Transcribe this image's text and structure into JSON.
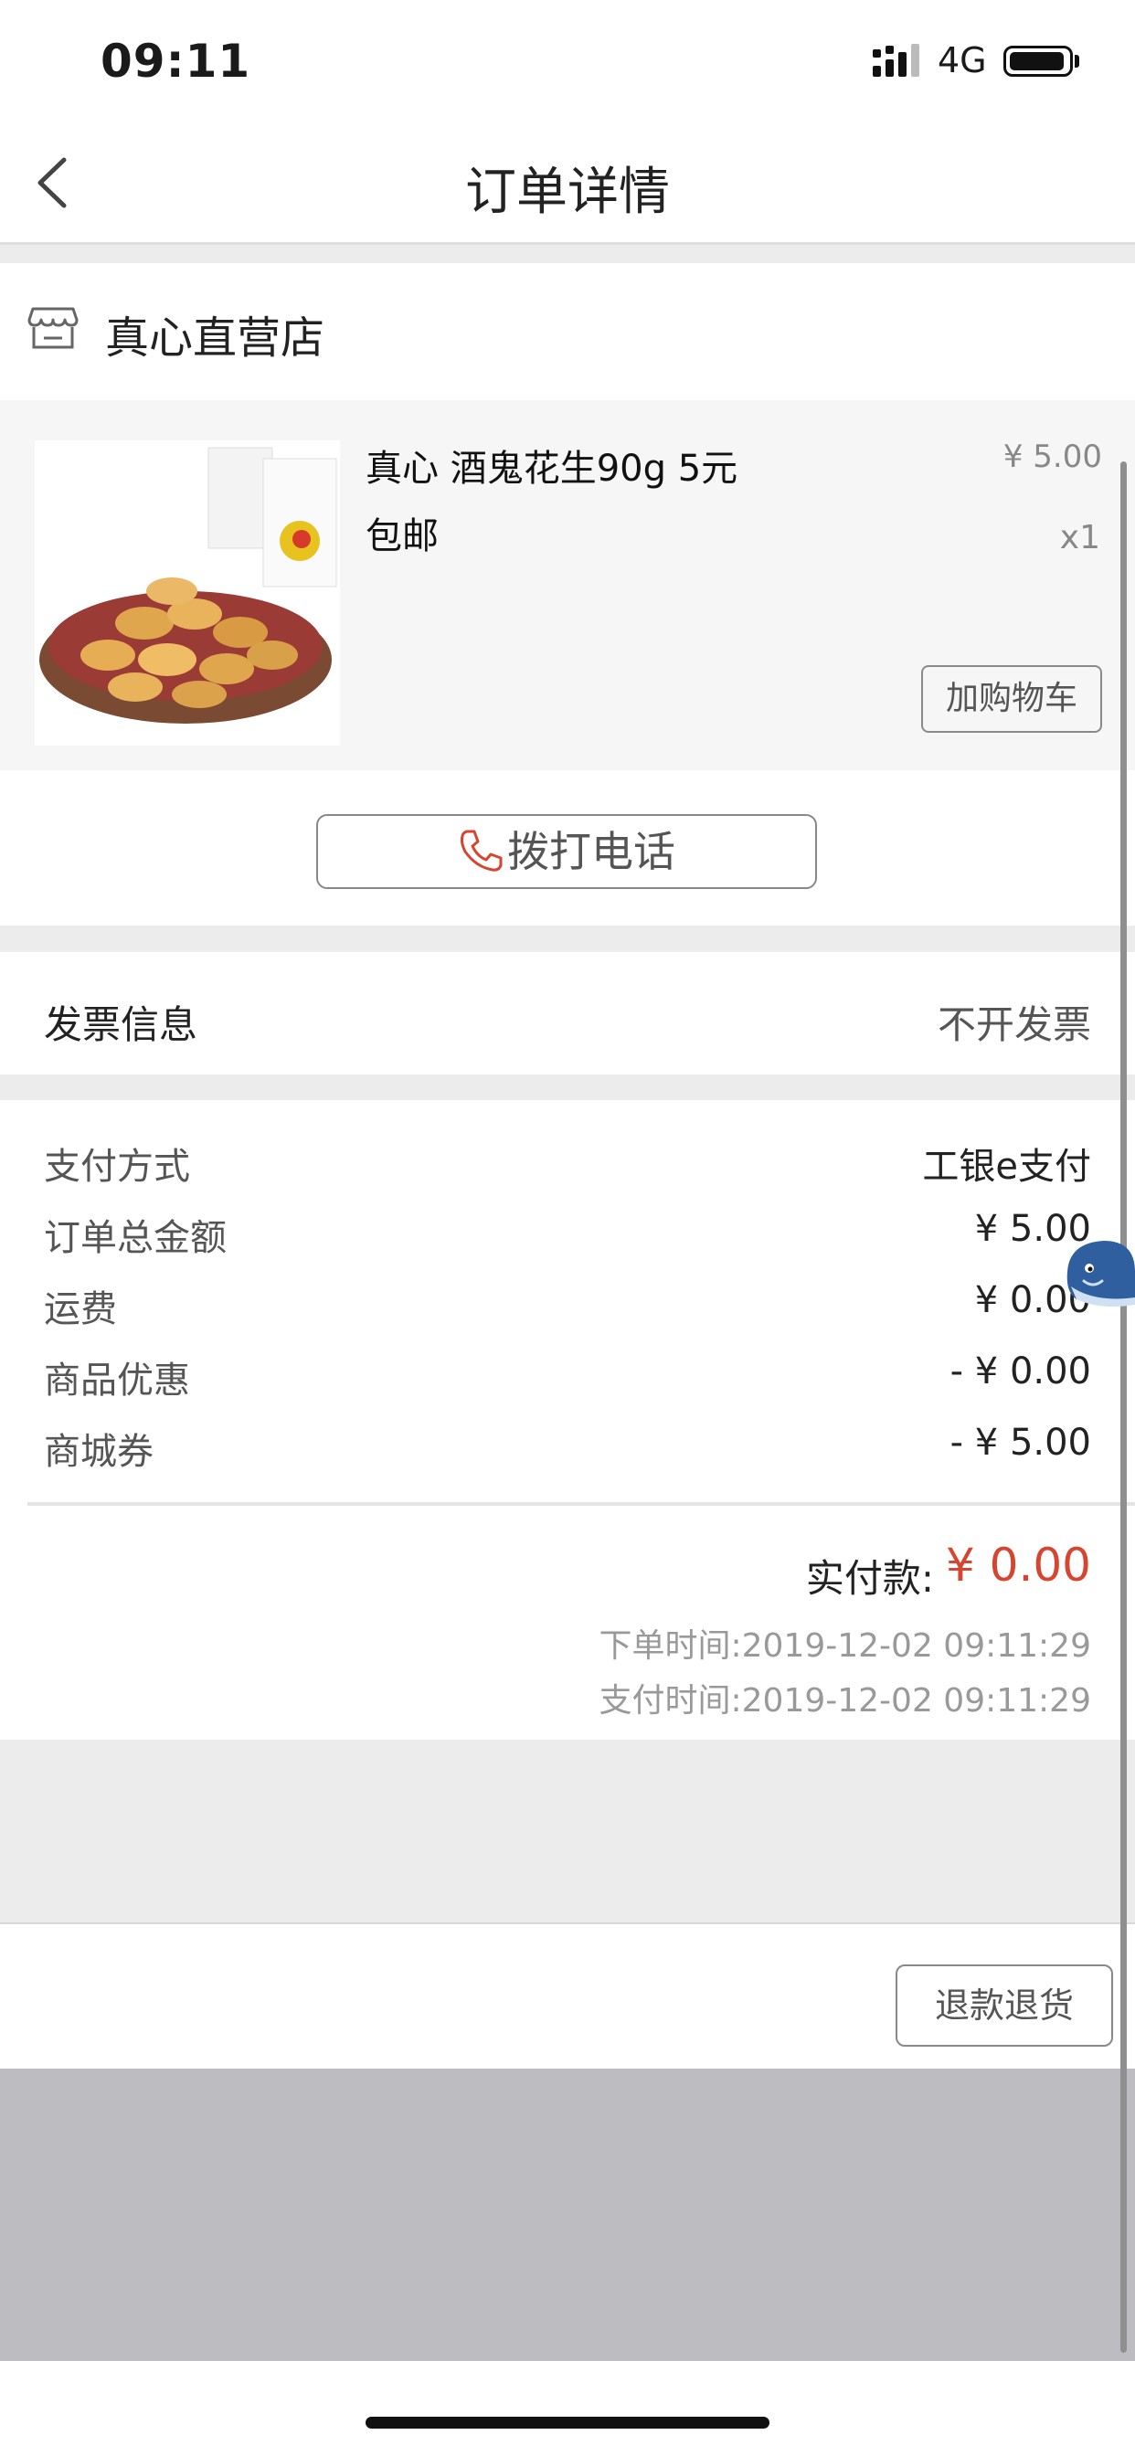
{
  "status_bar": {
    "time": "09:11",
    "network": "4G",
    "battery_level": 0.95
  },
  "nav": {
    "title": "订单详情",
    "back_icon": "chevron-left-icon"
  },
  "store": {
    "name": "真心直营店",
    "icon": "store-icon"
  },
  "product": {
    "name": "真心 酒鬼花生90g 5元包邮",
    "price": "¥ 5.00",
    "quantity": "x1",
    "add_cart_label": "加购物车"
  },
  "call": {
    "label": "拨打电话",
    "icon": "phone-icon"
  },
  "invoice": {
    "label": "发票信息",
    "value": "不开发票"
  },
  "payment": {
    "rows": [
      {
        "label": "支付方式",
        "value": "工银e支付"
      },
      {
        "label": "订单总金额",
        "value": "¥ 5.00"
      },
      {
        "label": "运费",
        "value": "¥ 0.00"
      },
      {
        "label": "商品优惠",
        "value": "- ¥ 0.00"
      },
      {
        "label": "商城券",
        "value": "- ¥ 5.00"
      }
    ],
    "actual_label": "实付款:",
    "actual_value": "¥ 0.00",
    "order_time": "下单时间:2019-12-02 09:11:29",
    "pay_time": "支付时间:2019-12-02 09:11:29"
  },
  "actions": {
    "refund_label": "退款退货"
  },
  "colors": {
    "accent": "#d6452f",
    "background_gray": "#ececec",
    "overlay_gray": "#bcbcc1"
  }
}
